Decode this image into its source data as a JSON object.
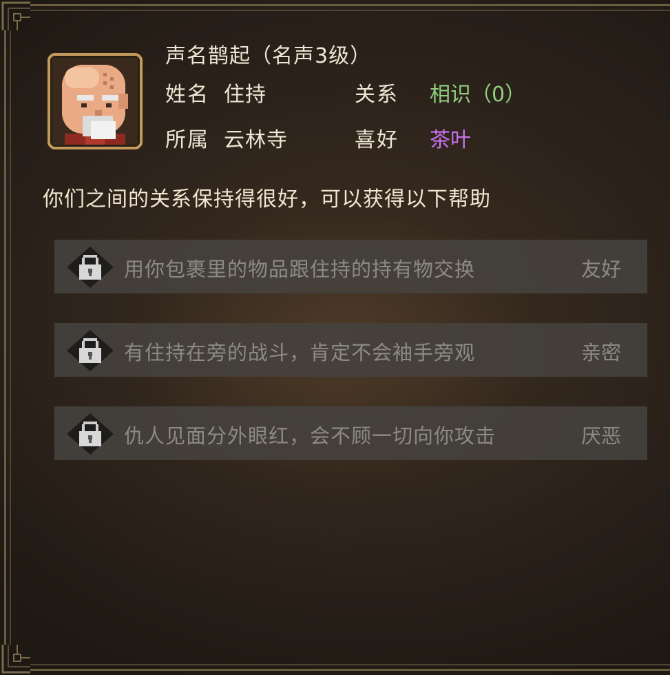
{
  "npc": {
    "title": "声名鹊起（名声3级）",
    "name_label": "姓名",
    "name_value": "住持",
    "relation_label": "关系",
    "relation_value": "相识（0）",
    "faction_label": "所属",
    "faction_value": "云林寺",
    "hobby_label": "喜好",
    "hobby_value": "茶叶"
  },
  "description": "你们之间的关系保持得很好，可以获得以下帮助",
  "help_items": [
    {
      "icon": "lock-icon",
      "text": "用你包裹里的物品跟住持的持有物交换",
      "requirement": "友好"
    },
    {
      "icon": "lock-icon",
      "text": "有住持在旁的战斗，肯定不会袖手旁观",
      "requirement": "亲密"
    },
    {
      "icon": "lock-icon",
      "text": "仇人见面分外眼红，会不顾一切向你攻击",
      "requirement": "厌恶"
    }
  ],
  "colors": {
    "relation": "#8fd07e",
    "hobby": "#c873f2",
    "locked_text": "#8d8a86",
    "frame": "#6b5d44"
  }
}
